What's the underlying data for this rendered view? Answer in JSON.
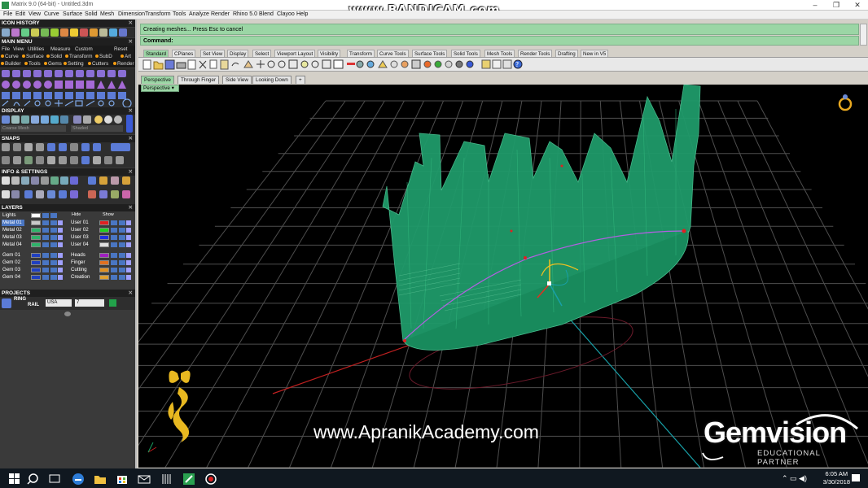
{
  "window": {
    "title": "Matrix 9.0 (64-bit) - Untitled.3dm",
    "watermark": "www.BANDICAM.com",
    "controls": [
      "–",
      "❐",
      "✕"
    ]
  },
  "menu": [
    "File",
    "Edit",
    "View",
    "Curve",
    "Surface",
    "Solid",
    "Mesh",
    "Dimension",
    "Transform",
    "Tools",
    "Analyze",
    "Render",
    "Rhino 5.0",
    "Blend",
    "Clayoo",
    "Help"
  ],
  "left_panel": {
    "icon_history": "ICON HISTORY",
    "main_menu": {
      "title": "MAIN MENU",
      "row1": [
        "File",
        "View",
        "Utilities",
        "Measure",
        "Custom",
        "Reset"
      ],
      "row2": [
        "Curve",
        "Surface",
        "Solid",
        "Transform",
        "SubD",
        "Art"
      ],
      "row3": [
        "Builder",
        "Tools",
        "Gems",
        "Setting",
        "Cutters",
        "Render"
      ]
    },
    "display": {
      "title": "DISPLAY",
      "dropdown1": "Coarse Mesh",
      "dropdown2": "Shaded"
    },
    "snaps": {
      "title": "SNAPS"
    },
    "info": {
      "title": "INFO & SETTINGS"
    },
    "layers": {
      "title": "LAYERS",
      "hide_label": "Hide",
      "show_label": "Show",
      "lights_label": "Lights",
      "left": [
        {
          "name": "Metal 01",
          "color": "#c9c9c9"
        },
        {
          "name": "Metal 02",
          "color": "#2fb36a"
        },
        {
          "name": "Metal 03",
          "color": "#2fb36a"
        },
        {
          "name": "Metal 04",
          "color": "#2fb36a"
        },
        {
          "name": "Gem 01",
          "color": "#2040c0"
        },
        {
          "name": "Gem 02",
          "color": "#2040c0"
        },
        {
          "name": "Gem 03",
          "color": "#2040c0"
        },
        {
          "name": "Gem 04",
          "color": "#2040c0"
        }
      ],
      "right": [
        {
          "name": "User 01",
          "color": "#e02020"
        },
        {
          "name": "User 02",
          "color": "#20d020"
        },
        {
          "name": "User 03",
          "color": "#2030e0"
        },
        {
          "name": "User 04",
          "color": "#e0e0e0"
        },
        {
          "name": "Heads",
          "color": "#a020c0"
        },
        {
          "name": "Finger",
          "color": "#e07020"
        },
        {
          "name": "Cutting",
          "color": "#e09020"
        },
        {
          "name": "Creation",
          "color": "#e0a030"
        }
      ]
    },
    "projects": {
      "title": "PROJECTS",
      "ring_label": "RING",
      "rail_label": "RAIL",
      "region": "USA",
      "size": "7"
    }
  },
  "command": {
    "history_text": "Creating meshes... Press Esc to cancel",
    "prompt_label": "Command:"
  },
  "toolbar_tabs": [
    "Standard",
    "CPlanes",
    "Set View",
    "Display",
    "Select",
    "Viewport Layout",
    "Visibility",
    "Transform",
    "Curve Tools",
    "Surface Tools",
    "Solid Tools",
    "Mesh Tools",
    "Render Tools",
    "Drafting",
    "New in V5"
  ],
  "viewport_tabs": [
    "Perspective",
    "Through Finger",
    "Side View",
    "Looking Down",
    "+"
  ],
  "viewport_label": "Perspective",
  "overlay": {
    "website": "www.ApranikAcademy.com",
    "gemvision": "Gemvision",
    "partner": "EDUCATIONAL PARTNER"
  },
  "taskbar": {
    "time": "6:05 AM",
    "date": "3/30/2018"
  },
  "colors": {
    "model": "#1f9a6a",
    "grid": "#5a5a5a",
    "command_bg": "#9bd6a5",
    "panel_bg": "#3a3a3a"
  }
}
